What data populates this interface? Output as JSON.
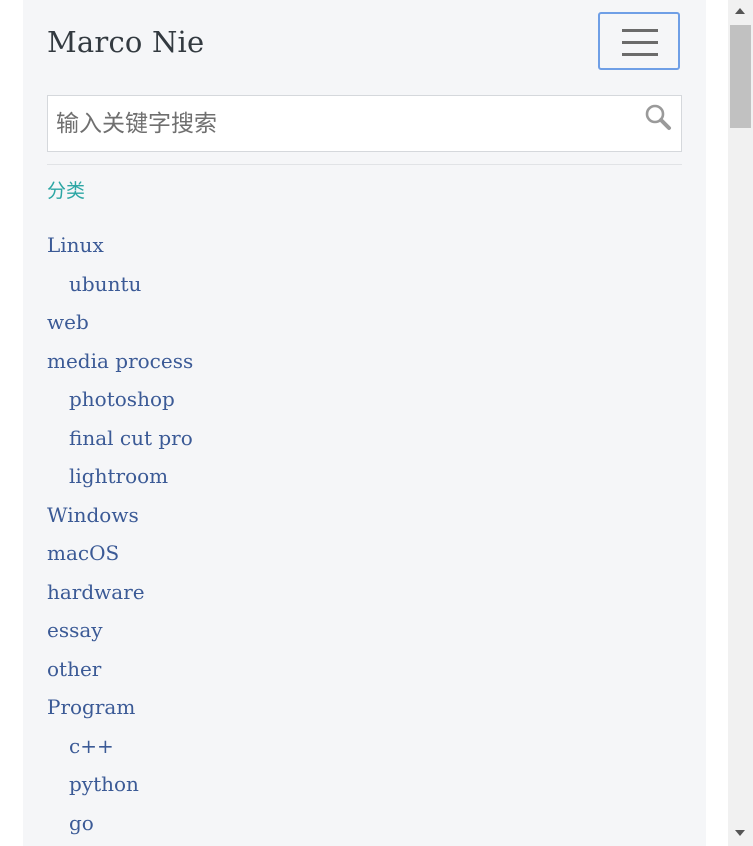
{
  "header": {
    "brand": "Marco Nie",
    "menu_button": "toggle-navigation"
  },
  "search": {
    "placeholder": "输入关键字搜索",
    "value": "",
    "icon": "search-icon"
  },
  "categories": {
    "title": "分类",
    "items": [
      {
        "label": "Linux",
        "level": 0
      },
      {
        "label": "ubuntu",
        "level": 1
      },
      {
        "label": "web",
        "level": 0
      },
      {
        "label": "media process",
        "level": 0
      },
      {
        "label": "photoshop",
        "level": 1
      },
      {
        "label": "final cut pro",
        "level": 1
      },
      {
        "label": "lightroom",
        "level": 1
      },
      {
        "label": "Windows",
        "level": 0
      },
      {
        "label": "macOS",
        "level": 0
      },
      {
        "label": "hardware",
        "level": 0
      },
      {
        "label": "essay",
        "level": 0
      },
      {
        "label": "other",
        "level": 0
      },
      {
        "label": "Program",
        "level": 0
      },
      {
        "label": "c++",
        "level": 1
      },
      {
        "label": "python",
        "level": 1
      },
      {
        "label": "go",
        "level": 1
      }
    ]
  },
  "colors": {
    "link": "#3b5a96",
    "section_title": "#2ca6a4",
    "toggler_border": "#6f9fe6",
    "panel_bg": "#f5f6f8"
  }
}
